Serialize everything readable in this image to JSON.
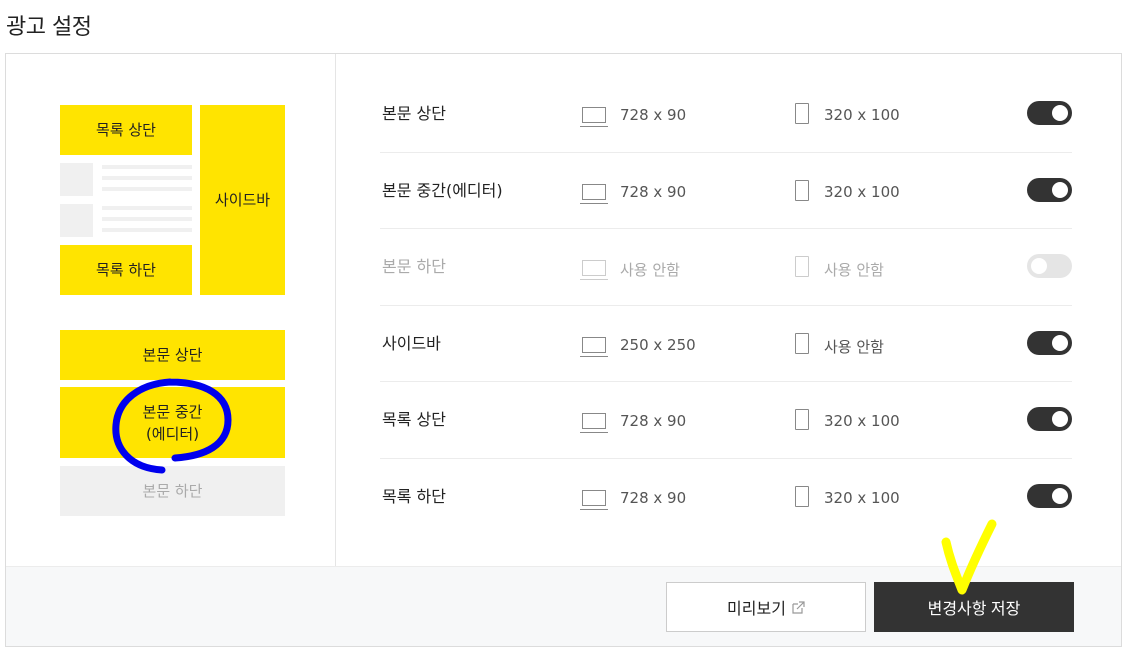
{
  "page": {
    "title": "광고 설정"
  },
  "preview": {
    "list_top": "목록 상단",
    "sidebar": "사이드바",
    "list_bottom": "목록 하단",
    "body_top": "본문 상단",
    "body_middle_line1": "본문 중간",
    "body_middle_line2": "(에디터)",
    "body_bottom": "본문 하단"
  },
  "rows": [
    {
      "name": "본문 상단",
      "pc": "728 x 90",
      "mobile": "320 x 100",
      "enabled": true
    },
    {
      "name": "본문 중간(에디터)",
      "pc": "728 x 90",
      "mobile": "320 x 100",
      "enabled": true
    },
    {
      "name": "본문 하단",
      "pc": "사용 안함",
      "mobile": "사용 안함",
      "enabled": false
    },
    {
      "name": "사이드바",
      "pc": "250 x 250",
      "mobile": "사용 안함",
      "enabled": true
    },
    {
      "name": "목록 상단",
      "pc": "728 x 90",
      "mobile": "320 x 100",
      "enabled": true
    },
    {
      "name": "목록 하단",
      "pc": "728 x 90",
      "mobile": "320 x 100",
      "enabled": true
    }
  ],
  "footer": {
    "preview_label": "미리보기",
    "save_label": "변경사항 저장"
  },
  "colors": {
    "ad_yellow": "#ffe400",
    "toggle_on": "#333333",
    "toggle_off": "#e5e5e5",
    "save_button": "#333333",
    "annotation_circle": "#0000ee",
    "annotation_check": "#ffff00"
  }
}
